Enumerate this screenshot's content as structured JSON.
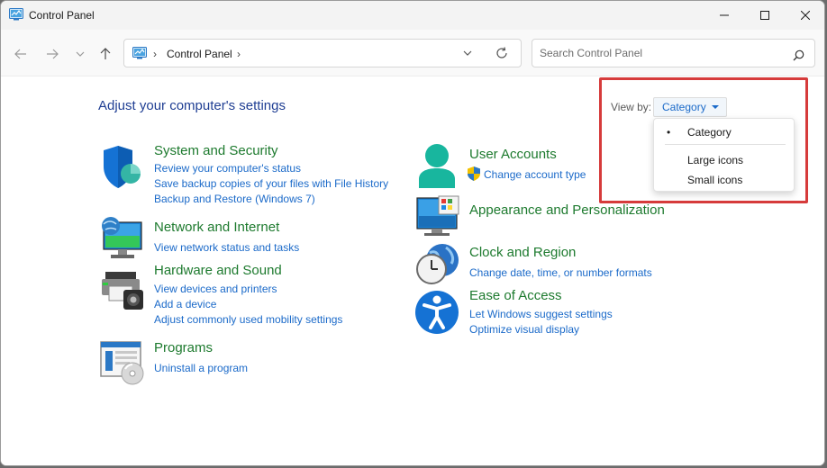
{
  "window": {
    "title": "Control Panel"
  },
  "navigation": {
    "breadcrumb": [
      "Control Panel"
    ],
    "search_placeholder": "Search Control Panel"
  },
  "main": {
    "page_title": "Adjust your computer's settings",
    "view_by_label": "View by:",
    "view_by_value": "Category",
    "view_menu": {
      "items": [
        "Category",
        "Large icons",
        "Small icons"
      ],
      "selected": "Category",
      "bullet": "•"
    }
  },
  "categories": [
    {
      "title": "System and Security",
      "icon": "shield-icon",
      "links": [
        "Review your computer's status",
        "Save backup copies of your files with File History",
        "Backup and Restore (Windows 7)"
      ]
    },
    {
      "title": "Network and Internet",
      "icon": "network-globe-icon",
      "links": [
        "View network status and tasks"
      ]
    },
    {
      "title": "Hardware and Sound",
      "icon": "printer-speaker-icon",
      "links": [
        "View devices and printers",
        "Add a device",
        "Adjust commonly used mobility settings"
      ]
    },
    {
      "title": "Programs",
      "icon": "programs-disc-icon",
      "links": [
        "Uninstall a program"
      ]
    },
    {
      "title": "User Accounts",
      "icon": "user-icon",
      "links": [
        "Change account type"
      ]
    },
    {
      "title": "Appearance and Personalization",
      "icon": "monitor-personalize-icon",
      "links": []
    },
    {
      "title": "Clock and Region",
      "icon": "clock-globe-icon",
      "links": [
        "Change date, time, or number formats"
      ]
    },
    {
      "title": "Ease of Access",
      "icon": "accessibility-icon",
      "links": [
        "Let Windows suggest settings",
        "Optimize visual display"
      ]
    }
  ],
  "colors": {
    "category_title": "#1d7a2e",
    "link": "#1b6ac9",
    "page_title": "#1f3e93",
    "highlight": "#d63b3b"
  }
}
